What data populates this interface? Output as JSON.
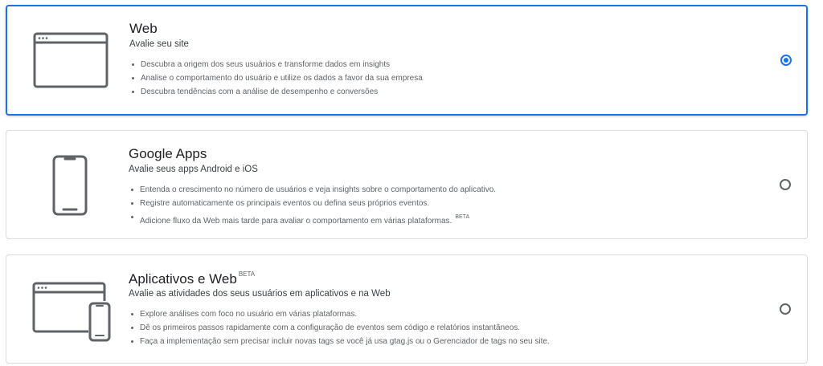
{
  "options": [
    {
      "title": "Web",
      "subtitle": "Avalie seu site",
      "icon": "browser-window-icon",
      "selected": true,
      "bullets": [
        "Descubra a origem dos seus usuários e transforme dados em insights",
        "Analise o comportamento do usuário e utilize os dados a favor da sua empresa",
        "Descubra tendências com a análise de desempenho e conversões"
      ]
    },
    {
      "title": "Google Apps",
      "subtitle": "Avalie seus apps Android e iOS",
      "icon": "smartphone-icon",
      "selected": false,
      "bullets": [
        "Entenda o crescimento no número de usuários e veja insights sobre o comportamento do aplicativo.",
        "Registre automaticamente os principais eventos ou defina seus próprios eventos.",
        "Adicione fluxo da Web mais tarde para avaliar o comportamento em várias plataformas."
      ],
      "bullet_badge": "BETA"
    },
    {
      "title": "Aplicativos e Web",
      "title_badge": "BETA",
      "subtitle": "Avalie as atividades dos seus usuários em aplicativos e na Web",
      "icon": "browser-and-phone-icon",
      "selected": false,
      "bullets": [
        "Explore análises com foco no usuário em várias plataformas.",
        "Dê os primeiros passos rapidamente com a configuração de eventos sem código e relatórios instantâneos.",
        "Faça a implementação sem precisar incluir novas tags se você já usa gtag.js ou o Gerenciador de tags no seu site."
      ]
    }
  ],
  "colors": {
    "accent": "#1a73e8",
    "border": "#dadce0",
    "text_primary": "#202124",
    "text_secondary": "#5f6368"
  }
}
